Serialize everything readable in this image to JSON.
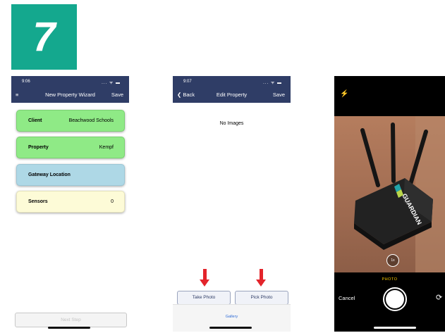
{
  "step_badge": {
    "number": "7",
    "color": "#14a88e"
  },
  "screen1": {
    "status_time": "9:06",
    "status_icons": "... ᯤ ▬",
    "menu_icon": "≡",
    "nav_title": "New Property Wizard",
    "nav_save": "Save",
    "cards": [
      {
        "label": "Client",
        "value": "Beachwood Schools",
        "color": "#8fea86"
      },
      {
        "label": "Property",
        "value": "Kempf",
        "color": "#8fea86"
      },
      {
        "label": "Gateway Location",
        "value": "",
        "color": "#aed8e6"
      },
      {
        "label": "Sensors",
        "value": "0",
        "color": "#fdfbd7"
      }
    ],
    "next_step": "Next Step"
  },
  "screen2": {
    "status_time": "9:07",
    "status_icons": "... ᯤ ▬",
    "nav_back": "❮ Back",
    "nav_title": "Edit Property",
    "nav_save": "Save",
    "empty_text": "No Images",
    "take_photo": "Take Photo",
    "pick_photo": "Pick Photo",
    "tab_gallery": "Gallery",
    "arrow_color": "#e3242b"
  },
  "screen3": {
    "flash_icon": "⚡",
    "zoom_label": "1x",
    "mode_label": "PHOTO",
    "cancel": "Cancel",
    "flip_icon": "⟳",
    "device_brand": "GUARDIAN"
  }
}
